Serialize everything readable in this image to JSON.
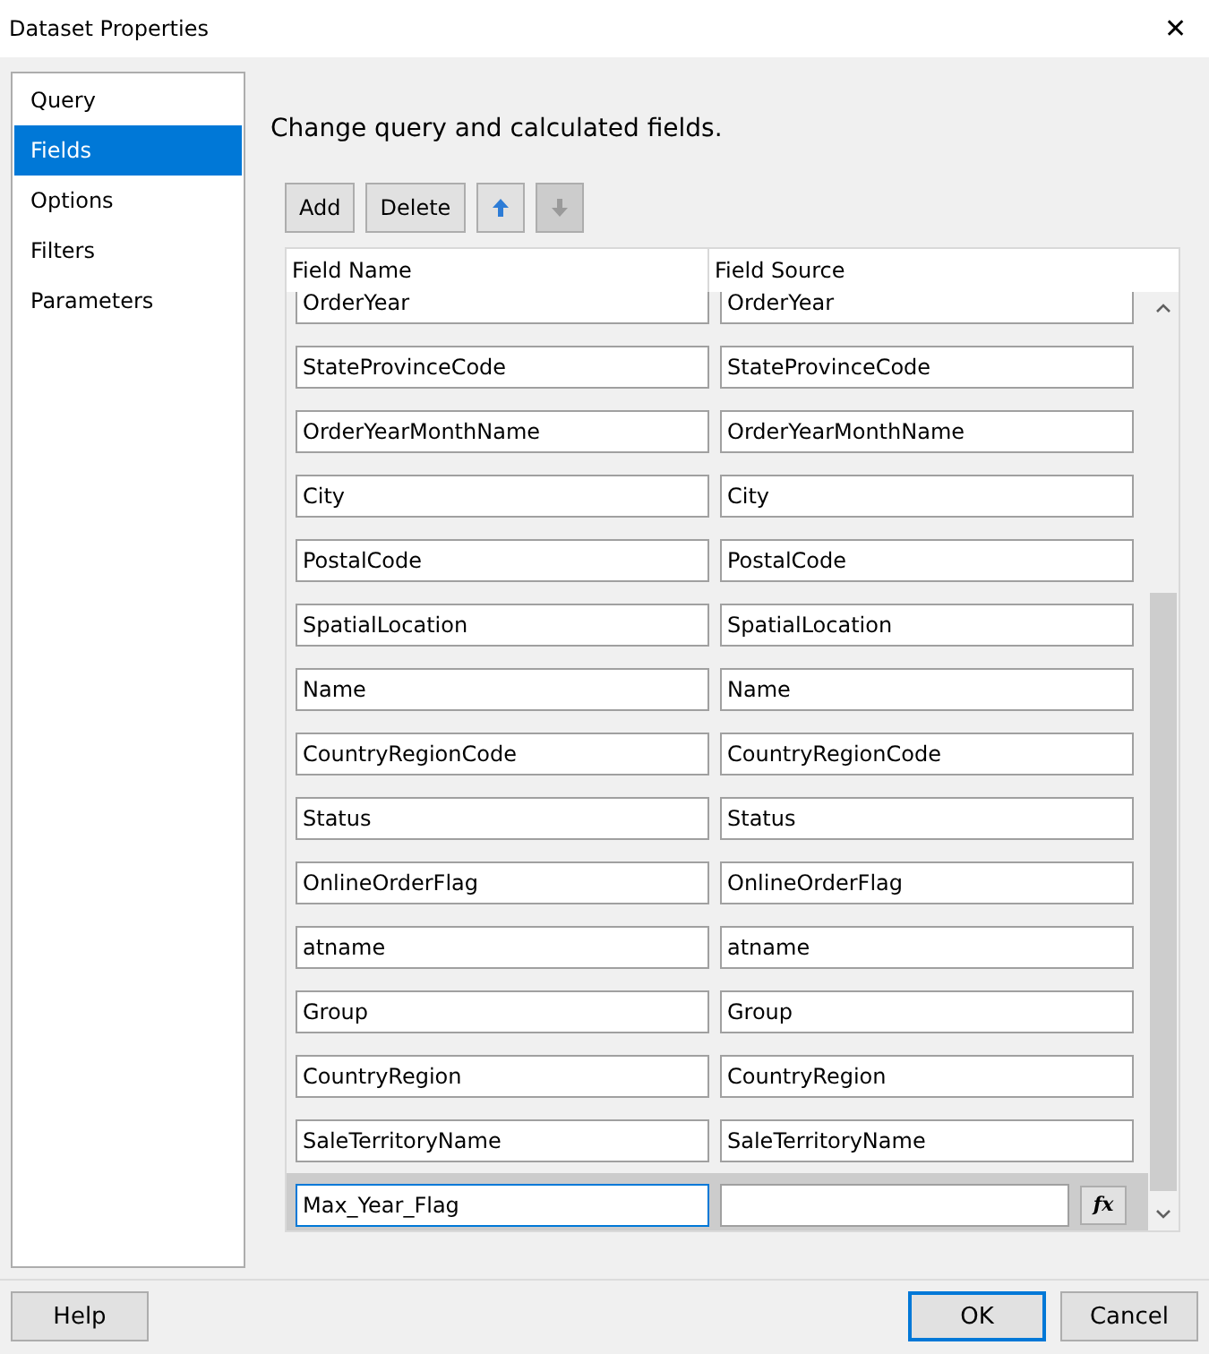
{
  "window": {
    "title": "Dataset Properties",
    "close_glyph": "✕"
  },
  "sidebar": {
    "items": [
      {
        "label": "Query",
        "selected": false
      },
      {
        "label": "Fields",
        "selected": true
      },
      {
        "label": "Options",
        "selected": false
      },
      {
        "label": "Filters",
        "selected": false
      },
      {
        "label": "Parameters",
        "selected": false
      }
    ]
  },
  "heading": "Change query and calculated fields.",
  "toolbar": [
    {
      "kind": "text",
      "label": "Add",
      "disabled": false
    },
    {
      "kind": "text",
      "label": "Delete",
      "disabled": false
    },
    {
      "kind": "move_up",
      "disabled": false
    },
    {
      "kind": "move_down",
      "disabled": true
    }
  ],
  "grid": {
    "columns": [
      "Field Name",
      "Field Source"
    ],
    "expression_button": "fx",
    "rows": [
      {
        "kind": "query",
        "name": "OrderYear",
        "source": "OrderYear",
        "selected": false
      },
      {
        "kind": "query",
        "name": "StateProvinceCode",
        "source": "StateProvinceCode",
        "selected": false
      },
      {
        "kind": "query",
        "name": "OrderYearMonthName",
        "source": "OrderYearMonthName",
        "selected": false
      },
      {
        "kind": "query",
        "name": "City",
        "source": "City",
        "selected": false
      },
      {
        "kind": "query",
        "name": "PostalCode",
        "source": "PostalCode",
        "selected": false
      },
      {
        "kind": "query",
        "name": "SpatialLocation",
        "source": "SpatialLocation",
        "selected": false
      },
      {
        "kind": "query",
        "name": "Name",
        "source": "Name",
        "selected": false
      },
      {
        "kind": "query",
        "name": "CountryRegionCode",
        "source": "CountryRegionCode",
        "selected": false
      },
      {
        "kind": "query",
        "name": "Status",
        "source": "Status",
        "selected": false
      },
      {
        "kind": "query",
        "name": "OnlineOrderFlag",
        "source": "OnlineOrderFlag",
        "selected": false
      },
      {
        "kind": "query",
        "name": "atname",
        "source": "atname",
        "selected": false
      },
      {
        "kind": "query",
        "name": "Group",
        "source": "Group",
        "selected": false
      },
      {
        "kind": "query",
        "name": "CountryRegion",
        "source": "CountryRegion",
        "selected": false
      },
      {
        "kind": "query",
        "name": "SaleTerritoryName",
        "source": "SaleTerritoryName",
        "selected": false
      },
      {
        "kind": "calculated",
        "name": "Max_Year_Flag",
        "selected": true
      }
    ]
  },
  "footer": {
    "help": "Help",
    "ok": "OK",
    "cancel": "Cancel"
  }
}
